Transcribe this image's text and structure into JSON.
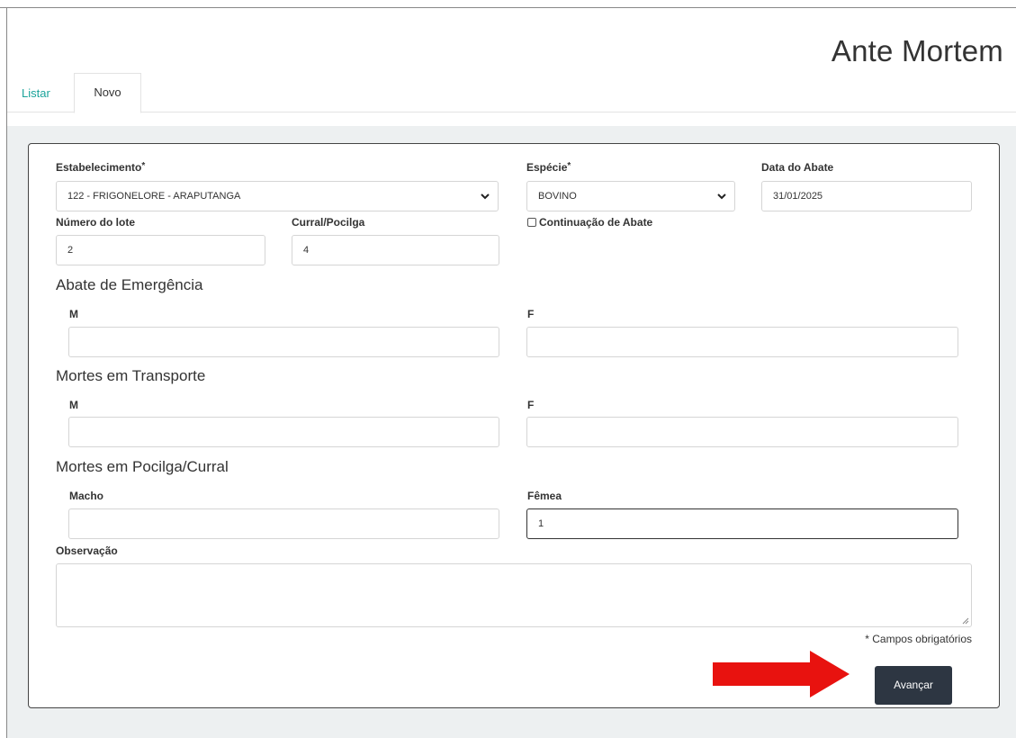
{
  "page_title": "Ante Mortem",
  "tabs": [
    {
      "label": "Listar",
      "active": false
    },
    {
      "label": "Novo",
      "active": true
    }
  ],
  "form": {
    "estabelecimento": {
      "label": "Estabelecimento",
      "required_mark": "*",
      "value": "122 - FRIGONELORE - ARAPUTANGA"
    },
    "especie": {
      "label": "Espécie",
      "required_mark": "*",
      "value": "BOVINO"
    },
    "data_abate": {
      "label": "Data do Abate",
      "value": "31/01/2025"
    },
    "numero_lote": {
      "label": "Número do lote",
      "value": "2"
    },
    "curral_pocilga": {
      "label": "Curral/Pocilga",
      "value": "4"
    },
    "continuacao_abate": {
      "label": "Continuação de Abate",
      "checked": false
    },
    "abate_emergencia": {
      "title": "Abate de Emergência",
      "m_label": "M",
      "f_label": "F",
      "m_value": "",
      "f_value": ""
    },
    "mortes_transporte": {
      "title": "Mortes em Transporte",
      "m_label": "M",
      "f_label": "F",
      "m_value": "",
      "f_value": ""
    },
    "mortes_pocilga": {
      "title": "Mortes em Pocilga/Curral",
      "macho_label": "Macho",
      "femea_label": "Fêmea",
      "macho_value": "",
      "femea_value": "1"
    },
    "observacao": {
      "label": "Observação",
      "value": ""
    },
    "required_note": "* Campos obrigatórios",
    "submit_label": "Avançar"
  },
  "colors": {
    "tab_link": "#1aa39a",
    "primary_button": "#2d3642",
    "annotation_arrow": "#e8120f",
    "content_bg": "#edf0f1"
  }
}
